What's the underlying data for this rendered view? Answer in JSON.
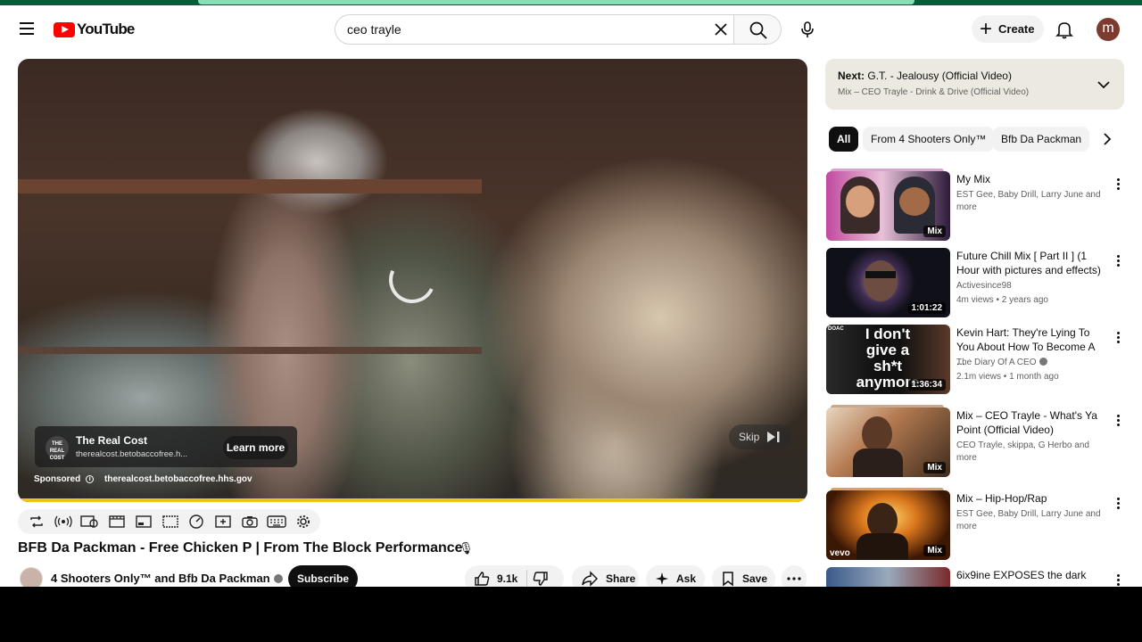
{
  "masthead": {
    "logo_text": "YouTube",
    "search_value": "ceo trayle",
    "create_label": "Create",
    "avatar_letter": "m"
  },
  "player": {
    "ad_title": "The Real Cost",
    "ad_url": "therealcost.betobaccofree.h...",
    "ad_logo_text": "THE REAL COST",
    "learn_more": "Learn more",
    "sponsored": "Sponsored",
    "sponsored_url": "therealcost.betobaccofree.hhs.gov",
    "skip": "Skip"
  },
  "video": {
    "title": "BFB Da Packman - Free Chicken P | From The Block Performance",
    "title_icon": "🎙",
    "channel": "4 Shooters Only™ and Bfb Da Packman",
    "subscribe": "Subscribe",
    "likes": "9.1k",
    "share": "Share",
    "ask": "Ask",
    "save": "Save"
  },
  "next": {
    "label": "Next:",
    "title": "G.T. - Jealousy (Official Video)",
    "subtitle": "Mix – CEO Trayle - Drink & Drive (Official Video)"
  },
  "chips": [
    "All",
    "From 4 Shooters Only™",
    "Bfb Da Packman"
  ],
  "recommendations": [
    {
      "title": "My Mix",
      "meta1": "EST Gee, Baby Drill, Larry June and more",
      "meta2": "",
      "badge": "Mix",
      "colors": [
        "#c04aa0",
        "#2d1b3a"
      ]
    },
    {
      "title": "Future Chill Mix [ Part II ] (1 Hour with pictures and effects)",
      "meta1": "Activesince98",
      "meta2": "4m views • 2 years ago",
      "badge": "1:01:22",
      "colors": [
        "#2a1f4a",
        "#101018"
      ]
    },
    {
      "title": "Kevin Hart: They're Lying To You About How To Become A ...",
      "meta1": "The Diary Of A CEO",
      "meta2": "2.1m views • 1 month ago",
      "badge": "1:36:34",
      "colors": [
        "#111111",
        "#b01d1d"
      ]
    },
    {
      "title": "Mix – CEO Trayle - What's Ya Point (Official Video)",
      "meta1": "CEO Trayle, skippa, G Herbo and more",
      "meta2": "",
      "badge": "Mix",
      "colors": [
        "#b57b52",
        "#3c2a1c"
      ]
    },
    {
      "title": "Mix – Hip-Hop/Rap",
      "meta1": "EST Gee, Baby Drill, Larry June and more",
      "meta2": "",
      "badge": "Mix",
      "colors": [
        "#d9761c",
        "#3b1705"
      ]
    },
    {
      "title": "6ix9ine EXPOSES the dark",
      "meta1": "",
      "meta2": "",
      "badge": "",
      "colors": [
        "#3a5a8a",
        "#7a2a2a"
      ]
    }
  ],
  "thumb_text": {
    "kevin": "I don't give a sh*t anymore",
    "doac": "DOAC",
    "vevo": "vevo"
  }
}
